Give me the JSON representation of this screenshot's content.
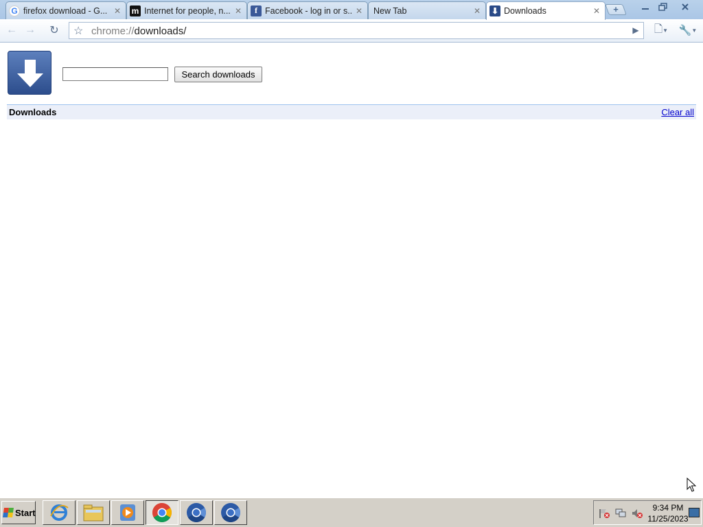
{
  "tabs": [
    {
      "title": "firefox download - G...",
      "favicon": "google-g-icon"
    },
    {
      "title": "Internet for people, n...",
      "favicon": "mozilla-m-icon"
    },
    {
      "title": "Facebook - log in or s...",
      "favicon": "facebook-f-icon"
    },
    {
      "title": "New Tab",
      "favicon": ""
    },
    {
      "title": "Downloads",
      "favicon": "download-arrow-icon",
      "active": true
    }
  ],
  "omnibox": {
    "scheme": "chrome://",
    "path": "downloads/"
  },
  "page": {
    "search_placeholder": "",
    "search_button_label": "Search downloads",
    "section_title": "Downloads",
    "clear_all_label": "Clear all"
  },
  "taskbar": {
    "start_label": "Start",
    "apps": [
      "internet-explorer-icon",
      "windows-explorer-icon",
      "media-player-icon",
      "chrome-icon",
      "chromium-icon",
      "chromium-icon"
    ],
    "time": "9:34 PM",
    "date": "11/25/2023"
  },
  "colors": {
    "tab_strip": "#aac6e6",
    "downloads_header_bg": "#ebeff9",
    "link": "#0000cc",
    "taskbar": "#d4d0c8"
  }
}
